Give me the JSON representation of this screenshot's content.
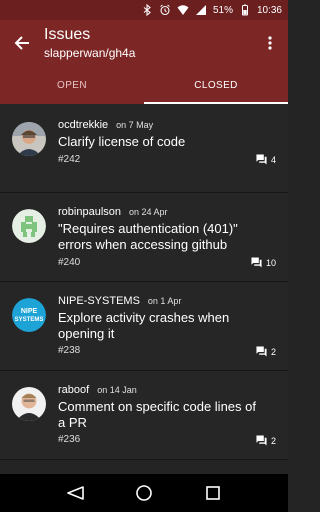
{
  "status_bar": {
    "battery": "51%",
    "time": "10:36",
    "icons": [
      "notification-icon",
      "bluetooth-icon",
      "alarm-icon",
      "wifi-icon",
      "signal-icon",
      "battery-icon"
    ]
  },
  "app_bar": {
    "title": "Issues",
    "subtitle": "slapperwan/gh4a",
    "back_icon": "arrow-back-icon",
    "menu_icon": "more-vert-icon"
  },
  "tabs": [
    {
      "label": "OPEN",
      "active": false
    },
    {
      "label": "CLOSED",
      "active": true
    }
  ],
  "issues": [
    {
      "user": "ocdtrekkie",
      "date": "on 7 May",
      "title": "Clarify license of code",
      "number": "#242",
      "comments": "4",
      "avatar": "ocdtrekkie-avatar"
    },
    {
      "user": "robinpaulson",
      "date": "on 24 Apr",
      "title": "\"Requires authentication (401)\" errors when accessing github",
      "number": "#240",
      "comments": "10",
      "avatar": "robinpaulson-avatar"
    },
    {
      "user": "NIPE-SYSTEMS",
      "date": "on 1 Apr",
      "title": "Explore activity crashes when opening it",
      "number": "#238",
      "comments": "2",
      "avatar": "nipe-systems-avatar",
      "avatar_text": "NIPE SYSTEMS"
    },
    {
      "user": "raboof",
      "date": "on 14 Jan",
      "title": "Comment on specific code lines of a PR",
      "number": "#236",
      "comments": "2",
      "avatar": "raboof-avatar"
    }
  ],
  "nav_bar": {
    "icons": [
      "back-nav-icon",
      "home-nav-icon",
      "recents-nav-icon"
    ]
  },
  "colors": {
    "status_bar": "#6b1f1f",
    "app_bar": "#7d2626",
    "background": "#242424",
    "nav_bar": "#000000"
  }
}
